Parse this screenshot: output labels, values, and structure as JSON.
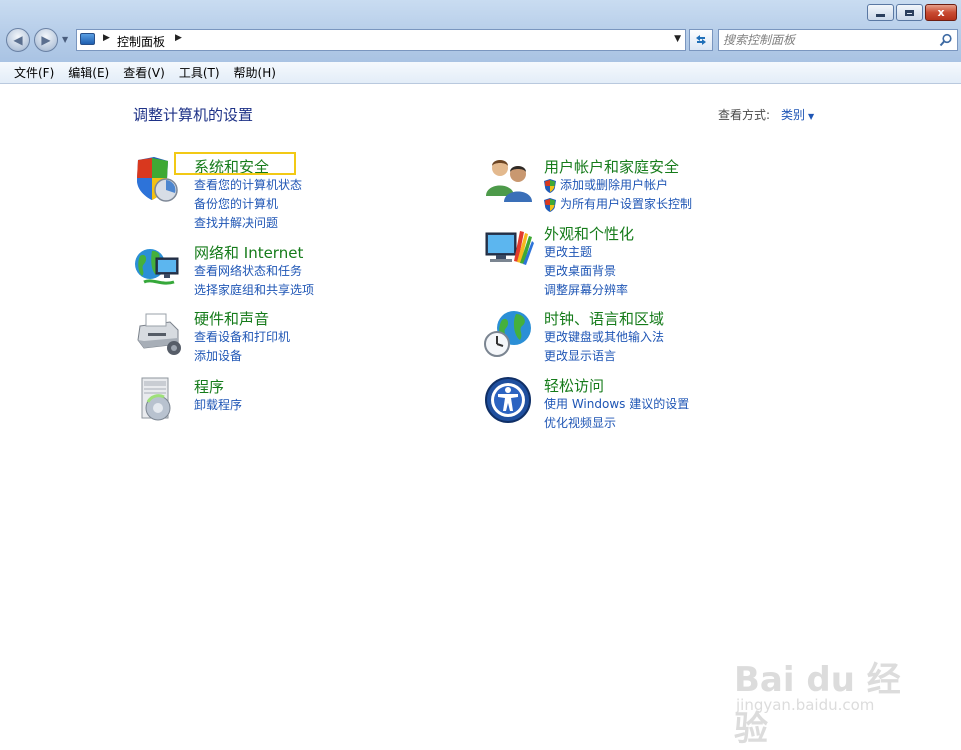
{
  "window": {
    "close_label": "x",
    "colors": {
      "link": "#1f56b5",
      "category_title": "#157b1a",
      "page_title": "#1e3287",
      "highlight": "#f2c915"
    }
  },
  "address": {
    "location": "控制面板",
    "icons": [
      "back-icon",
      "forward-icon",
      "control-panel-icon",
      "refresh-icon",
      "search-icon"
    ]
  },
  "search": {
    "placeholder": "搜索控制面板"
  },
  "menu": {
    "items": [
      "文件(F)",
      "编辑(E)",
      "查看(V)",
      "工具(T)",
      "帮助(H)"
    ]
  },
  "main": {
    "title": "调整计算机的设置",
    "view_label": "查看方式:",
    "view_value": "类别",
    "categories": [
      {
        "title": "系统和安全",
        "icon": "system-security-icon",
        "links": [
          "查看您的计算机状态",
          "备份您的计算机",
          "查找并解决问题"
        ]
      },
      {
        "title": "网络和 Internet",
        "icon": "network-internet-icon",
        "links": [
          "查看网络状态和任务",
          "选择家庭组和共享选项"
        ]
      },
      {
        "title": "硬件和声音",
        "icon": "hardware-sound-icon",
        "links": [
          "查看设备和打印机",
          "添加设备"
        ]
      },
      {
        "title": "程序",
        "icon": "programs-icon",
        "links": [
          "卸载程序"
        ]
      },
      {
        "title": "用户帐户和家庭安全",
        "icon": "user-accounts-icon",
        "links": [
          "添加或删除用户帐户",
          "为所有用户设置家长控制"
        ]
      },
      {
        "title": "外观和个性化",
        "icon": "appearance-icon",
        "links": [
          "更改主题",
          "更改桌面背景",
          "调整屏幕分辨率"
        ]
      },
      {
        "title": "时钟、语言和区域",
        "icon": "clock-language-icon",
        "links": [
          "更改键盘或其他输入法",
          "更改显示语言"
        ]
      },
      {
        "title": "轻松访问",
        "icon": "ease-of-access-icon",
        "links": [
          "使用 Windows 建议的设置",
          "优化视频显示"
        ]
      }
    ]
  },
  "watermark": {
    "main": "Bai du 经验",
    "sub": "jingyan.baidu.com"
  }
}
